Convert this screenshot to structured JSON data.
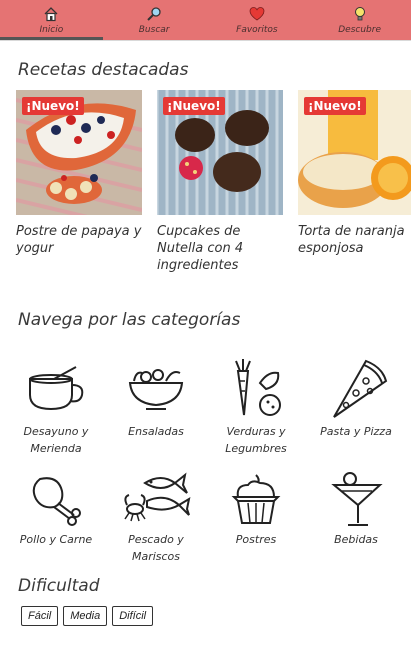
{
  "tabs": [
    {
      "label": "Inicio",
      "icon": "home-icon",
      "active": true
    },
    {
      "label": "Buscar",
      "icon": "search-icon",
      "active": false
    },
    {
      "label": "Favoritos",
      "icon": "heart-icon",
      "active": false
    },
    {
      "label": "Descubre",
      "icon": "lightbulb-icon",
      "active": false
    }
  ],
  "featured": {
    "title": "Recetas destacadas",
    "badge": "¡Nuevo!",
    "items": [
      {
        "name": "Postre de papaya y yogur"
      },
      {
        "name": "Cupcakes de Nutella con 4 ingredientes"
      },
      {
        "name": "Torta de naranja esponjosa"
      }
    ]
  },
  "categories": {
    "title": "Navega por las categorías",
    "items": [
      {
        "label": "Desayuno y Merienda",
        "icon": "cup-icon"
      },
      {
        "label": "Ensaladas",
        "icon": "salad-bowl-icon"
      },
      {
        "label": "Verduras y Legumbres",
        "icon": "vegetables-icon"
      },
      {
        "label": "Pasta y Pizza",
        "icon": "pizza-slice-icon"
      },
      {
        "label": "Pollo y Carne",
        "icon": "chicken-leg-icon"
      },
      {
        "label": "Pescado y Mariscos",
        "icon": "fish-icon"
      },
      {
        "label": "Postres",
        "icon": "cupcake-icon"
      },
      {
        "label": "Bebidas",
        "icon": "cocktail-icon"
      }
    ]
  },
  "difficulty": {
    "title": "Dificultad",
    "options": [
      "Fácil",
      "Media",
      "Difícil"
    ]
  },
  "colors": {
    "tabbar": "#e57373",
    "badge": "#e53935"
  }
}
